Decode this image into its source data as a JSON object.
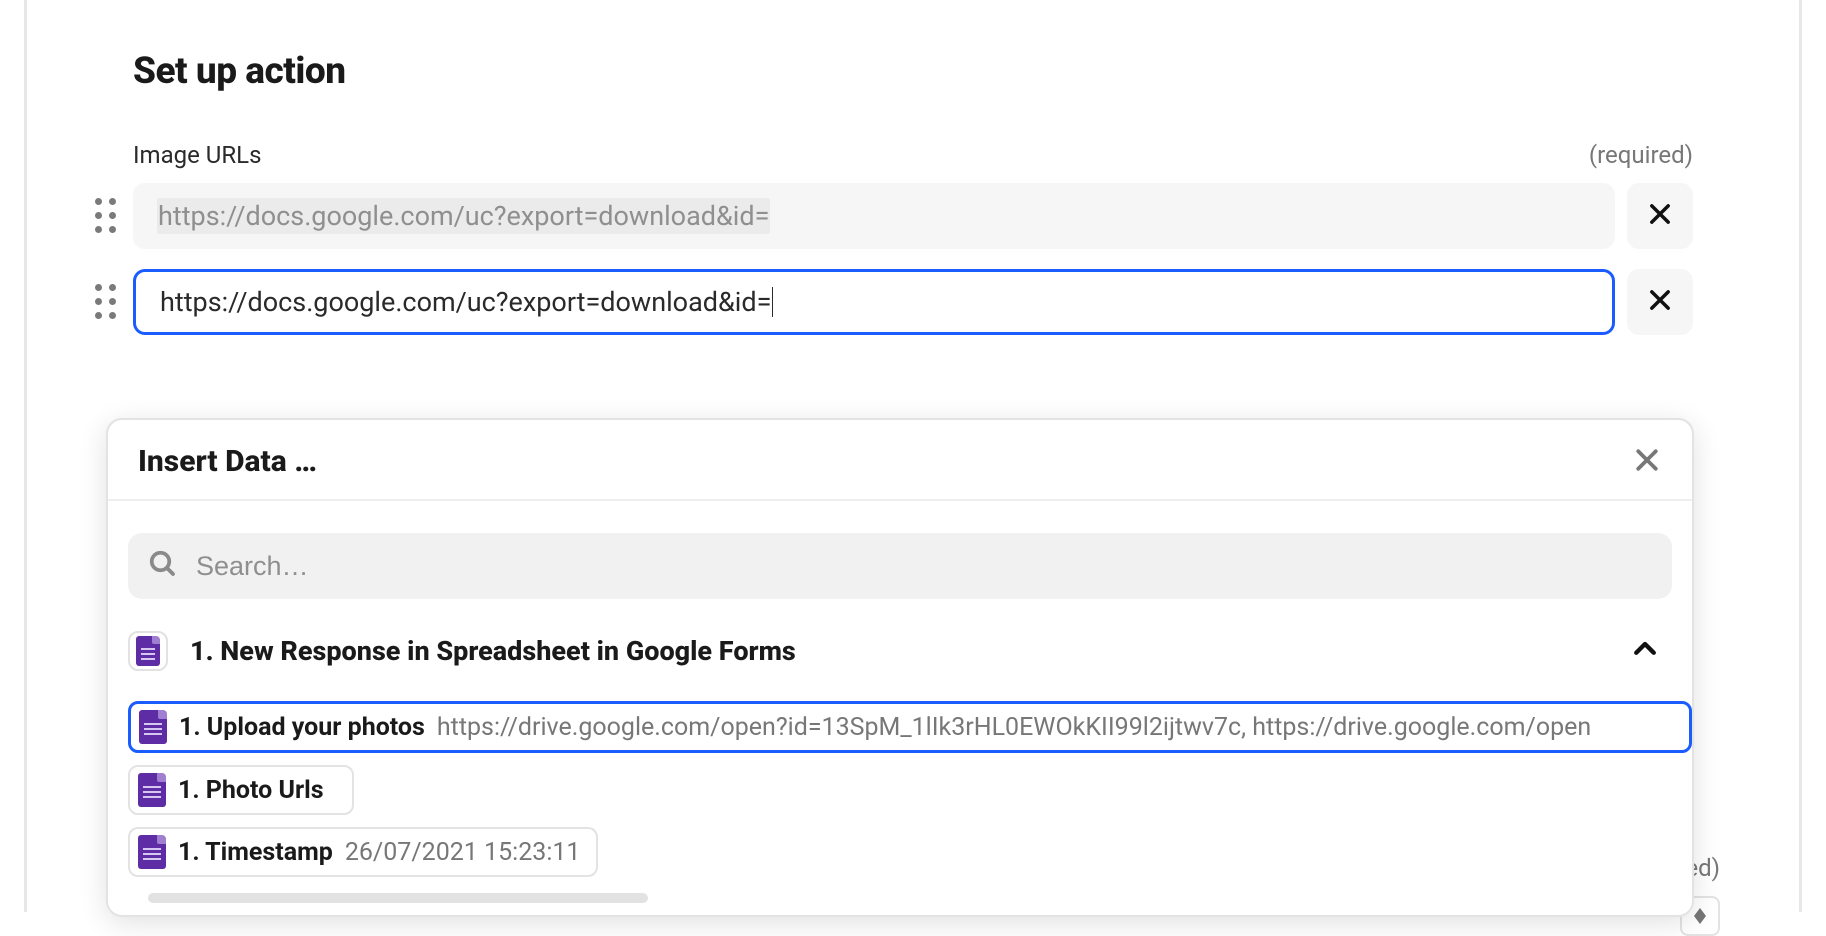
{
  "action": {
    "title": "Set up action",
    "field_label": "Image URLs",
    "required_label": "(required)",
    "url_inputs": [
      {
        "value": "https://docs.google.com/uc?export=download&id=",
        "state": "filled"
      },
      {
        "value": "https://docs.google.com/uc?export=download&id=",
        "state": "active"
      }
    ]
  },
  "dropdown": {
    "title": "Insert Data …",
    "search_placeholder": "Search…",
    "group": {
      "title": "1. New Response in Spreadsheet in Google Forms",
      "expanded": true
    },
    "fields": [
      {
        "label": "1. Upload your photos",
        "value": "https://drive.google.com/open?id=13SpM_1lIk3rHL0EWOkKII99l2ijtwv7c, https://drive.google.com/open",
        "selected": true
      },
      {
        "label": "1. Photo Urls",
        "value": "",
        "selected": false
      },
      {
        "label": "1. Timestamp",
        "value": "26/07/2021 15:23:11",
        "selected": false
      }
    ]
  },
  "bg": {
    "required_text": "equired)"
  }
}
